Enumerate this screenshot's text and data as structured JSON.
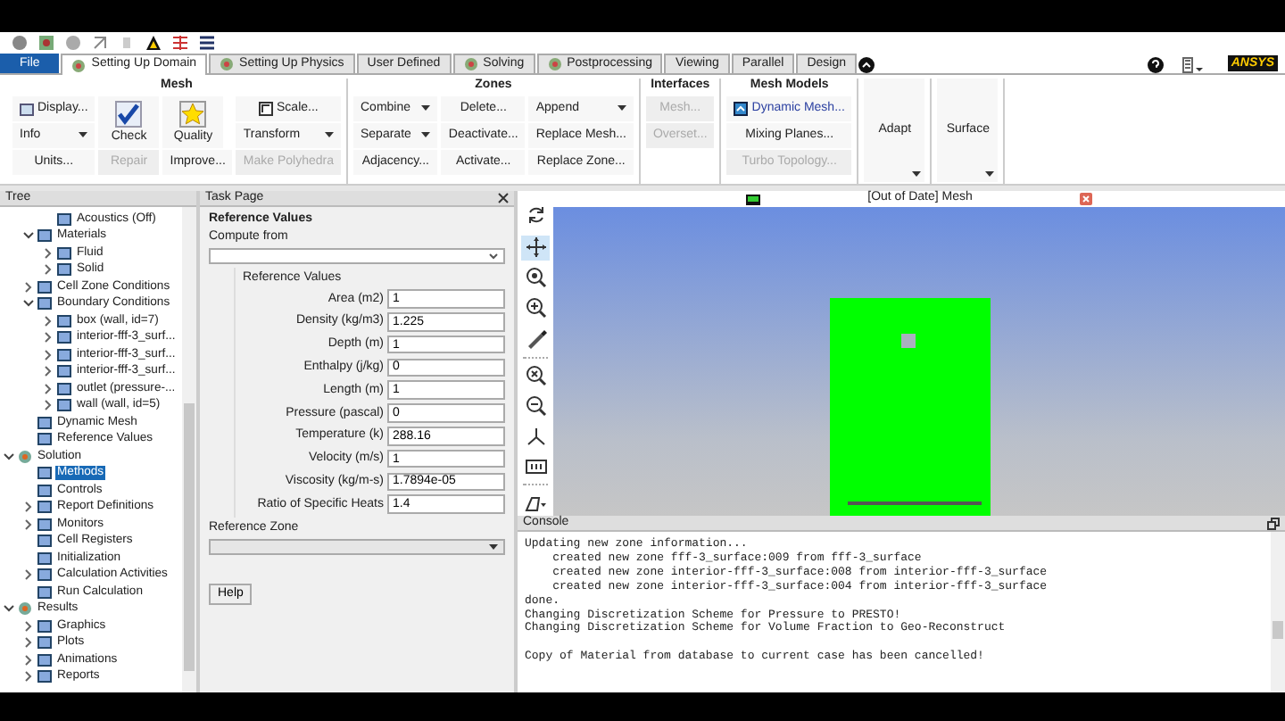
{
  "tabs": [
    {
      "label": "File",
      "kind": "file",
      "selected": false
    },
    {
      "label": "Setting Up Domain",
      "kind": "icon",
      "selected": true
    },
    {
      "label": "Setting Up Physics",
      "kind": "icon",
      "selected": false
    },
    {
      "label": "User Defined",
      "kind": "plain",
      "selected": false
    },
    {
      "label": "Solving",
      "kind": "icon",
      "selected": false
    },
    {
      "label": "Postprocessing",
      "kind": "icon",
      "selected": false
    },
    {
      "label": "Viewing",
      "kind": "plain",
      "selected": false
    },
    {
      "label": "Parallel",
      "kind": "plain",
      "selected": false
    },
    {
      "label": "Design",
      "kind": "plain",
      "selected": false
    }
  ],
  "logo": "ANSYS",
  "ribbon": [
    {
      "title": "Mesh",
      "columns": [
        [
          {
            "label": "Display...",
            "kind": "icon",
            "disabled": false
          },
          {
            "label": "Info",
            "kind": "menu",
            "disabled": false
          },
          {
            "label": "Units...",
            "kind": "plain",
            "disabled": false
          }
        ],
        [
          {
            "label": "Check",
            "kind": "large",
            "disabled": false
          },
          {
            "label": "Repair",
            "kind": "plain",
            "disabled": true
          }
        ],
        [
          {
            "label": "Quality",
            "kind": "large",
            "disabled": false
          },
          {
            "label": "Improve...",
            "kind": "plain",
            "disabled": false
          }
        ],
        [
          {
            "label": "Scale...",
            "kind": "icon",
            "disabled": false
          },
          {
            "label": "Transform",
            "kind": "menu",
            "disabled": false
          },
          {
            "label": "Make Polyhedra",
            "kind": "plain",
            "disabled": true
          }
        ]
      ]
    },
    {
      "title": "Zones",
      "columns": [
        [
          {
            "label": "Combine",
            "kind": "menu",
            "disabled": false
          },
          {
            "label": "Separate",
            "kind": "menu",
            "disabled": false
          },
          {
            "label": "Adjacency...",
            "kind": "plain",
            "disabled": false
          }
        ],
        [
          {
            "label": "Delete...",
            "kind": "plain",
            "disabled": false
          },
          {
            "label": "Deactivate...",
            "kind": "plain",
            "disabled": false
          },
          {
            "label": "Activate...",
            "kind": "plain",
            "disabled": false
          }
        ],
        [
          {
            "label": "Append",
            "kind": "menu",
            "disabled": false
          },
          {
            "label": "Replace Mesh...",
            "kind": "plain",
            "disabled": false
          },
          {
            "label": "Replace Zone...",
            "kind": "plain",
            "disabled": false
          }
        ]
      ]
    },
    {
      "title": "Interfaces",
      "columns": [
        [
          {
            "label": "Mesh...",
            "kind": "plain",
            "disabled": true
          },
          {
            "label": "Overset...",
            "kind": "plain",
            "disabled": true
          }
        ]
      ]
    },
    {
      "title": "Mesh Models",
      "columns": [
        [
          {
            "label": "Dynamic Mesh...",
            "kind": "icon",
            "disabled": false
          },
          {
            "label": "Mixing Planes...",
            "kind": "plain",
            "disabled": false
          },
          {
            "label": "Turbo Topology...",
            "kind": "plain",
            "disabled": true
          }
        ]
      ]
    },
    {
      "columns": [
        [
          {
            "label": "Adapt",
            "kind": "tall",
            "disabled": false
          }
        ]
      ]
    },
    {
      "columns": [
        [
          {
            "label": "Surface",
            "kind": "tall",
            "disabled": false
          }
        ]
      ]
    }
  ],
  "tree": {
    "title": "Tree",
    "items": [
      {
        "children": [
          {
            "children": [
              {
                "label": "Acoustics (Off)",
                "selected": false
              }
            ]
          },
          {
            "label": "Materials",
            "expanded": true,
            "selected": false,
            "children": [
              {
                "label": "Fluid",
                "expanded": false,
                "selected": false
              },
              {
                "label": "Solid",
                "expanded": false,
                "selected": false
              }
            ]
          },
          {
            "label": "Cell Zone Conditions",
            "expanded": false,
            "selected": false
          },
          {
            "label": "Boundary Conditions",
            "expanded": true,
            "selected": false,
            "children": [
              {
                "label": "box (wall, id=7)",
                "expanded": false,
                "selected": false
              },
              {
                "label": "interior-fff-3_surf...",
                "expanded": false,
                "selected": false
              },
              {
                "label": "interior-fff-3_surf...",
                "expanded": false,
                "selected": false
              },
              {
                "label": "interior-fff-3_surf...",
                "expanded": false,
                "selected": false
              },
              {
                "label": "outlet (pressure-...",
                "expanded": false,
                "selected": false
              },
              {
                "label": "wall (wall, id=5)",
                "expanded": false,
                "selected": false
              }
            ]
          },
          {
            "label": "Dynamic Mesh",
            "selected": false
          },
          {
            "label": "Reference Values",
            "selected": false
          }
        ]
      },
      {
        "label": "Solution",
        "expanded": true,
        "selected": false,
        "children": [
          {
            "label": "Methods",
            "selected": true
          },
          {
            "label": "Controls",
            "selected": false
          },
          {
            "label": "Report Definitions",
            "expanded": false,
            "selected": false
          },
          {
            "label": "Monitors",
            "expanded": false,
            "selected": false
          },
          {
            "label": "Cell Registers",
            "selected": false
          },
          {
            "label": "Initialization",
            "selected": false
          },
          {
            "label": "Calculation Activities",
            "expanded": false,
            "selected": false
          },
          {
            "label": "Run Calculation",
            "selected": false
          }
        ]
      },
      {
        "label": "Results",
        "expanded": true,
        "selected": false,
        "children": [
          {
            "label": "Graphics",
            "expanded": false,
            "selected": false
          },
          {
            "label": "Plots",
            "expanded": false,
            "selected": false
          },
          {
            "label": "Animations",
            "expanded": false,
            "selected": false
          },
          {
            "label": "Reports",
            "expanded": false,
            "selected": false
          }
        ]
      }
    ]
  },
  "task_page": {
    "title": "Task Page",
    "heading": "Reference Values",
    "compute_from": {
      "label": "Compute from"
    },
    "group": "Reference Values",
    "fields": [
      {
        "label": "Area (m2)",
        "value": "1"
      },
      {
        "label": "Density (kg/m3)",
        "value": "1.225"
      },
      {
        "label": "Depth (m)",
        "value": "1"
      },
      {
        "label": "Enthalpy (j/kg)",
        "value": "0"
      },
      {
        "label": "Length (m)",
        "value": "1"
      },
      {
        "label": "Pressure (pascal)",
        "value": "0"
      },
      {
        "label": "Temperature (k)",
        "value": "288.16"
      },
      {
        "label": "Velocity (m/s)",
        "value": "1"
      },
      {
        "label": "Viscosity (kg/m-s)",
        "value": "1.7894e-05"
      },
      {
        "label": "Ratio of Specific Heats",
        "value": "1.4"
      }
    ],
    "reference_zone": {
      "label": "Reference Zone"
    },
    "help": "Help"
  },
  "graphics": {
    "title": "[Out of Date] Mesh",
    "toolbar": [
      {
        "selected": false
      },
      {
        "selected": true
      },
      {
        "selected": false
      },
      {
        "selected": false
      },
      {
        "selected": false
      },
      {
        "selected": false
      },
      {
        "selected": false
      },
      {
        "selected": false
      },
      {
        "selected": false
      },
      {
        "selected": false
      }
    ]
  },
  "console": {
    "title": "Console",
    "blocks": [
      [
        "Updating new zone information...",
        "    created new zone fff-3_surface:009 from fff-3_surface",
        "    created new zone interior-fff-3_surface:008 from interior-fff-3_surface",
        "    created new zone interior-fff-3_surface:004 from interior-fff-3_surface",
        "done.",
        "Changing Discretization Scheme for Pressure to PRESTO!",
        "Changing Discretization Scheme for Volume Fraction to Geo-Reconstruct"
      ],
      [
        "Copy of Material from database to current case has been cancelled!"
      ]
    ]
  }
}
